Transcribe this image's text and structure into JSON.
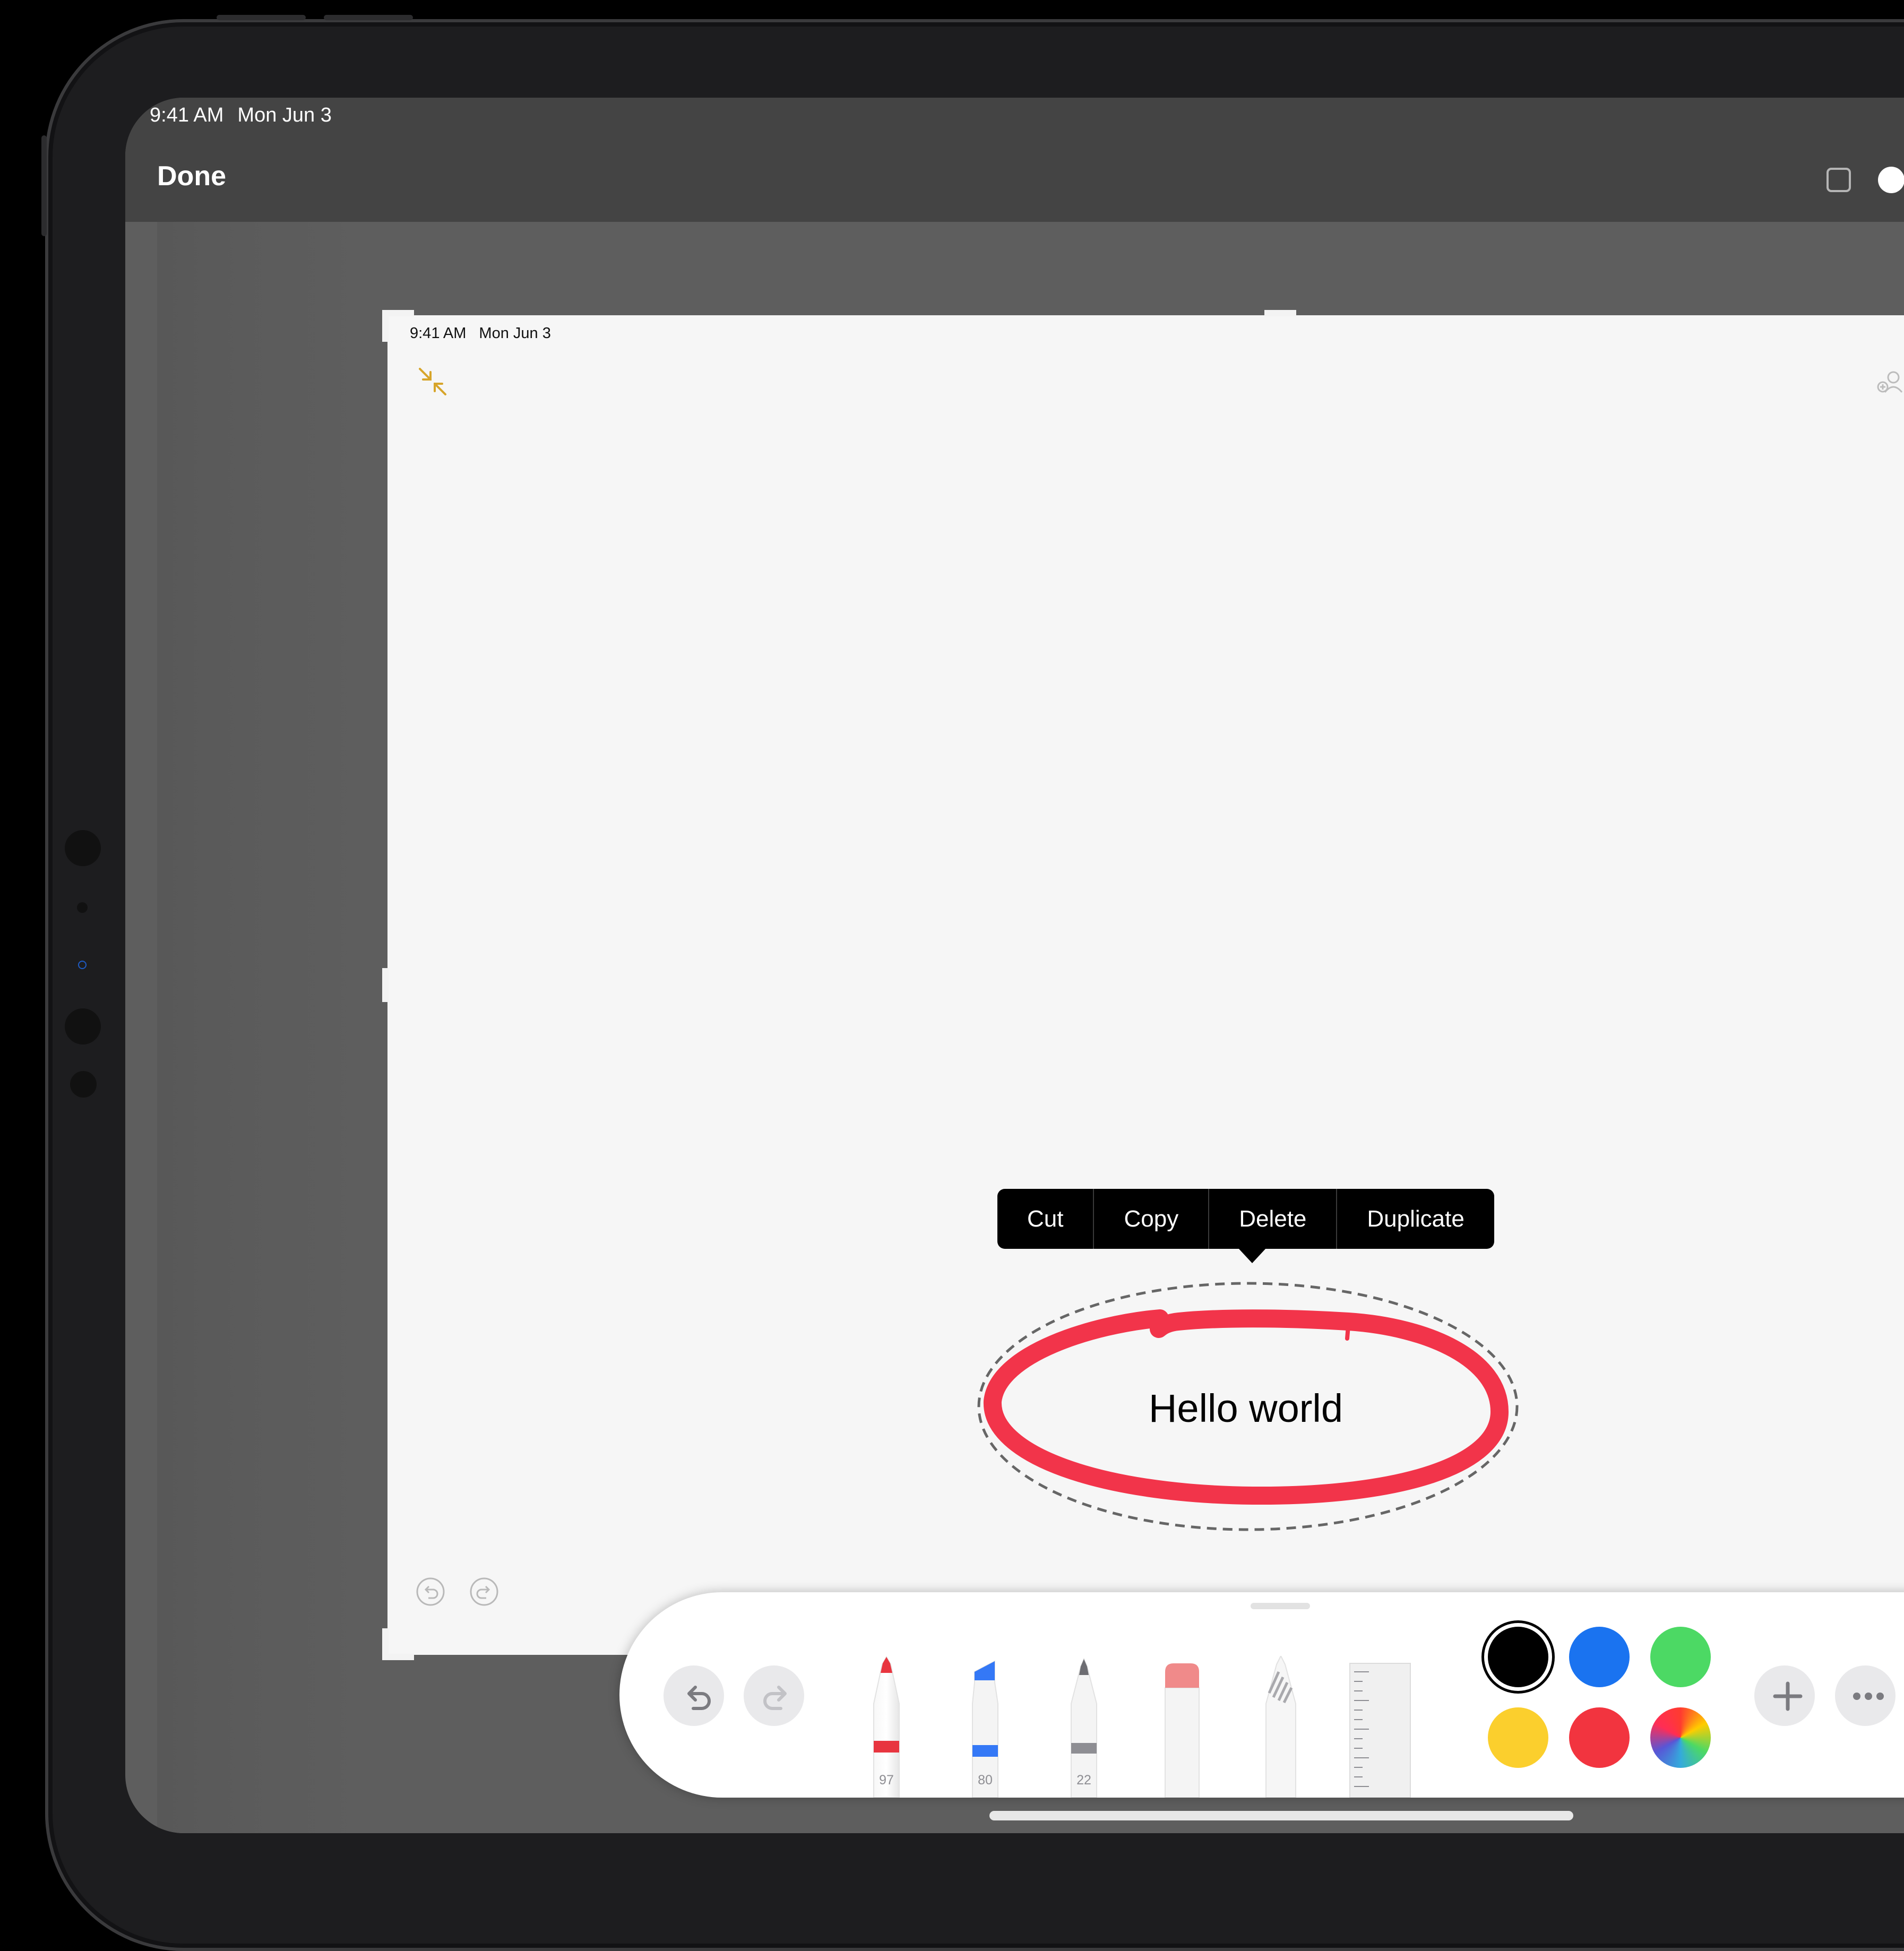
{
  "status_bar": {
    "time": "9:41 AM",
    "date": "Mon Jun 3"
  },
  "top_bar": {
    "done_label": "Done"
  },
  "canvas": {
    "status_bar": {
      "time": "9:41 AM",
      "date": "Mon Jun 3"
    },
    "text": "Hello world"
  },
  "context_menu": {
    "items": [
      "Cut",
      "Copy",
      "Delete",
      "Duplicate"
    ]
  },
  "toolbar": {
    "tools": [
      {
        "name": "pen",
        "value": "97",
        "color": "#e8353f"
      },
      {
        "name": "marker",
        "value": "80",
        "color": "#3478f6"
      },
      {
        "name": "pencil",
        "value": "22",
        "color": "#8e8e93"
      },
      {
        "name": "eraser",
        "color": "#f08a8a"
      },
      {
        "name": "lasso"
      },
      {
        "name": "ruler"
      }
    ],
    "colors": [
      "#000000",
      "#1a73f0",
      "#4cd964",
      "#fbcf2d",
      "#f2343f",
      "color-wheel"
    ],
    "selected_color": "#000000"
  },
  "icons": {
    "collapse": "collapse-arrows-icon",
    "share": "share-collaborate-icon",
    "undo": "undo-icon",
    "redo": "redo-icon",
    "add": "plus-icon",
    "more": "ellipsis-icon"
  }
}
